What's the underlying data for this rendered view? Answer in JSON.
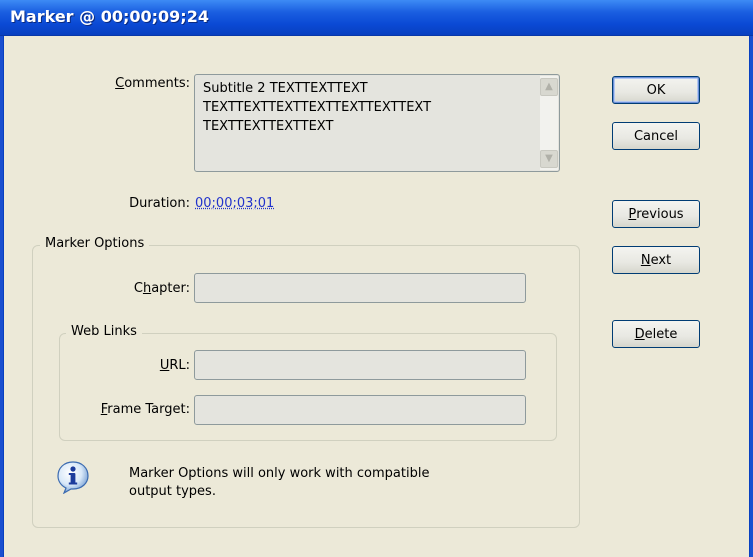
{
  "window": {
    "title": "Marker @ 00;00;09;24"
  },
  "comments": {
    "label_pre": "",
    "label_mnemonic": "C",
    "label_post": "omments:",
    "text": "Subtitle 2 TEXTTEXTTEXT\nTEXTTEXTTEXTTEXTTEXTTEXTTEXT\nTEXTTEXTTEXTTEXT"
  },
  "duration": {
    "label": "Duration:",
    "value": "00;00;03;01"
  },
  "marker_options": {
    "legend": "Marker Options",
    "chapter_label_pre": "C",
    "chapter_label_mnemonic": "h",
    "chapter_label_post": "apter:",
    "chapter_value": ""
  },
  "web_links": {
    "legend": "Web Links",
    "url_label_pre": "",
    "url_label_mnemonic": "U",
    "url_label_post": "RL:",
    "url_value": "",
    "frame_label_pre": "",
    "frame_label_mnemonic": "F",
    "frame_label_post": "rame Target:",
    "frame_value": ""
  },
  "info": {
    "text": "Marker Options will only work with compatible\noutput types."
  },
  "buttons": {
    "ok": "OK",
    "cancel": "Cancel",
    "previous_mnemonic": "P",
    "previous_rest": "revious",
    "next_mnemonic": "N",
    "next_rest": "ext",
    "delete_mnemonic": "D",
    "delete_rest": "elete"
  },
  "icons": {
    "scroll_up": "scroll-up-arrow",
    "scroll_down": "scroll-down-arrow",
    "info": "info-icon"
  }
}
